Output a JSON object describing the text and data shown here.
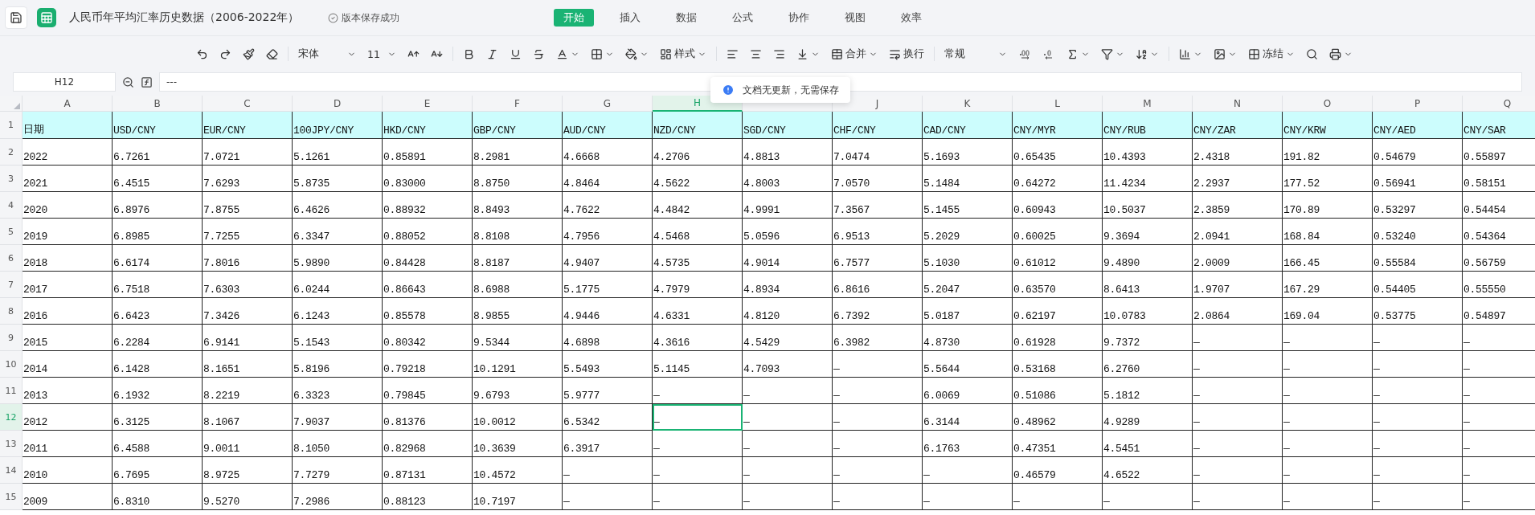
{
  "app": {
    "title": "人民币年平均汇率历史数据（2006-2022年）",
    "save_status": "版本保存成功"
  },
  "menu": [
    {
      "label": "开始",
      "selected": true
    },
    {
      "label": "插入",
      "selected": false
    },
    {
      "label": "数据",
      "selected": false
    },
    {
      "label": "公式",
      "selected": false
    },
    {
      "label": "协作",
      "selected": false
    },
    {
      "label": "视图",
      "selected": false
    },
    {
      "label": "效率",
      "selected": false
    }
  ],
  "toolbar": {
    "font": "宋体",
    "font_size": "11",
    "style": "样式",
    "merge": "合并",
    "wrap": "换行",
    "number_format": "常规",
    "freeze": "冻结"
  },
  "formula_bar": {
    "name_box": "H12",
    "value": "---"
  },
  "toast": "文档无更新，无需保存",
  "columns": [
    {
      "label": "A",
      "selected": false
    },
    {
      "label": "B",
      "selected": false
    },
    {
      "label": "C",
      "selected": false
    },
    {
      "label": "D",
      "selected": false
    },
    {
      "label": "E",
      "selected": false
    },
    {
      "label": "F",
      "selected": false
    },
    {
      "label": "G",
      "selected": false
    },
    {
      "label": "H",
      "selected": true
    },
    {
      "selected": false
    },
    {
      "label": "J",
      "selected": false
    },
    {
      "label": "K",
      "selected": false
    },
    {
      "label": "L",
      "selected": false
    },
    {
      "label": "M",
      "selected": false
    },
    {
      "label": "N",
      "selected": false
    },
    {
      "label": "O",
      "selected": false
    },
    {
      "label": "P",
      "selected": false
    },
    {
      "label": "Q",
      "selected": false
    }
  ],
  "rows": [
    {
      "header": "1",
      "kind": "header",
      "selected": false,
      "cells": [
        "日期",
        "USD/CNY",
        "EUR/CNY",
        "100JPY/CNY",
        "HKD/CNY",
        "GBP/CNY",
        "AUD/CNY",
        "NZD/CNY",
        "SGD/CNY",
        "CHF/CNY",
        "CAD/CNY",
        "CNY/MYR",
        "CNY/RUB",
        "CNY/ZAR",
        "CNY/KRW",
        "CNY/AED",
        "CNY/SAR"
      ]
    },
    {
      "header": "2",
      "kind": "data",
      "selected": false,
      "cells": [
        "2022",
        "6.7261",
        "7.0721",
        "5.1261",
        "0.85891",
        "8.2981",
        "4.6668",
        "4.2706",
        "4.8813",
        "7.0474",
        "5.1693",
        "0.65435",
        "10.4393",
        "2.4318",
        "191.82",
        "0.54679",
        "0.55897"
      ]
    },
    {
      "header": "3",
      "kind": "data",
      "selected": false,
      "cells": [
        "2021",
        "6.4515",
        "7.6293",
        "5.8735",
        "0.83000",
        "8.8750",
        "4.8464",
        "4.5622",
        "4.8003",
        "7.0570",
        "5.1484",
        "0.64272",
        "11.4234",
        "2.2937",
        "177.52",
        "0.56941",
        "0.58151"
      ]
    },
    {
      "header": "4",
      "kind": "data",
      "selected": false,
      "cells": [
        "2020",
        "6.8976",
        "7.8755",
        "6.4626",
        "0.88932",
        "8.8493",
        "4.7622",
        "4.4842",
        "4.9991",
        "7.3567",
        "5.1455",
        "0.60943",
        "10.5037",
        "2.3859",
        "170.89",
        "0.53297",
        "0.54454"
      ]
    },
    {
      "header": "5",
      "kind": "data",
      "selected": false,
      "cells": [
        "2019",
        "6.8985",
        "7.7255",
        "6.3347",
        "0.88052",
        "8.8108",
        "4.7956",
        "4.5468",
        "5.0596",
        "6.9513",
        "5.2029",
        "0.60025",
        "9.3694",
        "2.0941",
        "168.84",
        "0.53240",
        "0.54364"
      ]
    },
    {
      "header": "6",
      "kind": "data",
      "selected": false,
      "cells": [
        "2018",
        "6.6174",
        "7.8016",
        "5.9890",
        "0.84428",
        "8.8187",
        "4.9407",
        "4.5735",
        "4.9014",
        "6.7577",
        "5.1030",
        "0.61012",
        "9.4890",
        "2.0009",
        "166.45",
        "0.55584",
        "0.56759"
      ]
    },
    {
      "header": "7",
      "kind": "data",
      "selected": false,
      "cells": [
        "2017",
        "6.7518",
        "7.6303",
        "6.0244",
        "0.86643",
        "8.6988",
        "5.1775",
        "4.7979",
        "4.8934",
        "6.8616",
        "5.2047",
        "0.63570",
        "8.6413",
        "1.9707",
        "167.29",
        "0.54405",
        "0.55550"
      ]
    },
    {
      "header": "8",
      "kind": "data",
      "selected": false,
      "cells": [
        "2016",
        "6.6423",
        "7.3426",
        "6.1243",
        "0.85578",
        "8.9855",
        "4.9446",
        "4.6331",
        "4.8120",
        "6.7392",
        "5.0187",
        "0.62197",
        "10.0783",
        "2.0864",
        "169.04",
        "0.53775",
        "0.54897"
      ]
    },
    {
      "header": "9",
      "kind": "data",
      "selected": false,
      "cells": [
        "2015",
        "6.2284",
        "6.9141",
        "5.1543",
        "0.80342",
        "9.5344",
        "4.6898",
        "4.3616",
        "4.5429",
        "6.3982",
        "4.8730",
        "0.61928",
        "9.7372",
        "—",
        "—",
        "—",
        "—"
      ]
    },
    {
      "header": "10",
      "kind": "data",
      "selected": false,
      "cells": [
        "2014",
        "6.1428",
        "8.1651",
        "5.8196",
        "0.79218",
        "10.1291",
        "5.5493",
        "5.1145",
        "4.7093",
        "—",
        "5.5644",
        "0.53168",
        "6.2760",
        "—",
        "—",
        "—",
        "—"
      ]
    },
    {
      "header": "11",
      "kind": "data",
      "selected": false,
      "cells": [
        "2013",
        "6.1932",
        "8.2219",
        "6.3323",
        "0.79845",
        "9.6793",
        "5.9777",
        "—",
        "—",
        "—",
        "6.0069",
        "0.51086",
        "5.1812",
        "—",
        "—",
        "—",
        "—"
      ]
    },
    {
      "header": "12",
      "kind": "data",
      "selected": true,
      "cells": [
        "2012",
        "6.3125",
        "8.1067",
        "7.9037",
        "0.81376",
        "10.0012",
        "6.5342",
        "—",
        "—",
        "—",
        "6.3144",
        "0.48962",
        "4.9289",
        "—",
        "—",
        "—",
        "—"
      ]
    },
    {
      "header": "13",
      "kind": "data",
      "selected": false,
      "cells": [
        "2011",
        "6.4588",
        "9.0011",
        "8.1050",
        "0.82968",
        "10.3639",
        "6.3917",
        "—",
        "—",
        "—",
        "6.1763",
        "0.47351",
        "4.5451",
        "—",
        "—",
        "—",
        "—"
      ]
    },
    {
      "header": "14",
      "kind": "data",
      "selected": false,
      "cells": [
        "2010",
        "6.7695",
        "8.9725",
        "7.7279",
        "0.87131",
        "10.4572",
        "—",
        "—",
        "—",
        "—",
        "—",
        "0.46579",
        "4.6522",
        "—",
        "—",
        "—",
        "—"
      ]
    },
    {
      "header": "15",
      "kind": "data",
      "selected": false,
      "cells": [
        "2009",
        "6.8310",
        "9.5270",
        "7.2986",
        "0.88123",
        "10.7197",
        "—",
        "—",
        "—",
        "—",
        "—",
        "—",
        "—",
        "—",
        "—",
        "—",
        "—"
      ]
    }
  ]
}
